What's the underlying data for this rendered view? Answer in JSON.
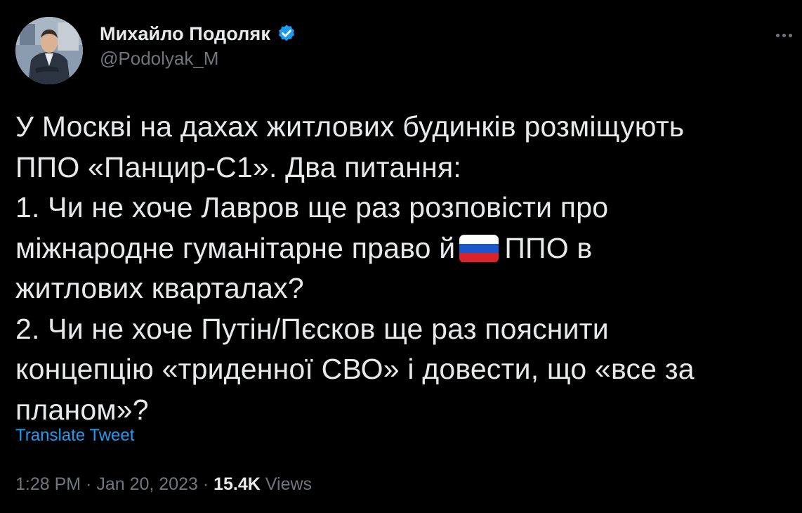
{
  "author": {
    "display_name": "Михайло Подоляк",
    "handle": "@Podolyak_M",
    "verified": true,
    "verified_color": "#1d9bf0"
  },
  "tweet": {
    "lines": [
      "У Москві на дахах житлових будинків розміщують",
      "ППО «Панцир-С1». Два питання:",
      "1. Чи не хоче Лавров ще раз розповісти про",
      "міжнародне гуманітарне право й",
      "ППО в",
      "житлових кварталах?",
      "2. Чи не хоче Путін/Пєсков ще раз пояснити",
      "концепцію «триденної СВО» і довести, що «все за",
      "планом»?"
    ],
    "emoji": "russia-flag-emoji",
    "translate_label": "Translate Tweet"
  },
  "meta": {
    "time": "1:28 PM",
    "sep1": " · ",
    "date": "Jan 20, 2023",
    "sep2": " · ",
    "views_count": "15.4K",
    "views_label": " Views"
  },
  "colors": {
    "background": "#000000",
    "text": "#e7e9ea",
    "secondary": "#71767b",
    "link": "#1d9bf0"
  },
  "icons": {
    "more": "more-dots-icon",
    "verified": "verified-badge-icon"
  }
}
